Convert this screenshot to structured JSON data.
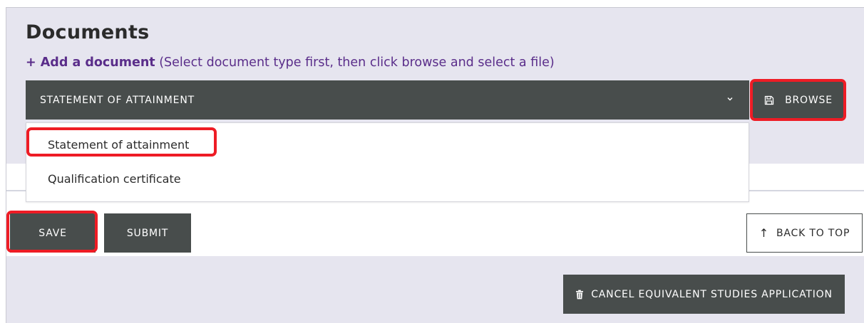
{
  "section": {
    "title": "Documents",
    "add_link": "+ Add a document",
    "add_hint": " (Select document type first, then click browse and select a file)"
  },
  "document_type_select": {
    "value": "STATEMENT OF ATTAINMENT",
    "icon": "chevron-down-icon",
    "options": [
      "Statement of attainment",
      "Qualification certificate"
    ]
  },
  "browse_button": {
    "label": "BROWSE",
    "icon": "floppy-disk-icon"
  },
  "actions": {
    "save_label": "SAVE",
    "submit_label": "SUBMIT",
    "back_to_top_label": "BACK TO TOP",
    "back_to_top_icon": "↑",
    "cancel_label": "CANCEL EQUIVALENT STUDIES APPLICATION",
    "cancel_icon": "trash-icon"
  },
  "colors": {
    "dark_button": "#484d4c",
    "panel_background": "#e6e5ef",
    "link_purple": "#5a2d8a",
    "highlight_red": "#ee1c25"
  }
}
